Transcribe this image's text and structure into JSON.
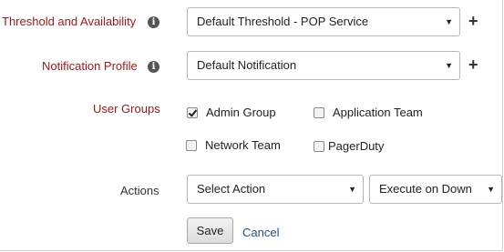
{
  "threshold": {
    "label": "Threshold and Availability",
    "info_glyph": "i",
    "selected": "Default Threshold - POP Service",
    "caret": "▼",
    "add_glyph": "+"
  },
  "notification": {
    "label": "Notification Profile",
    "info_glyph": "i",
    "selected": "Default Notification",
    "caret": "▼",
    "add_glyph": "+"
  },
  "user_groups": {
    "label": "User Groups",
    "options": [
      {
        "label": "Admin Group",
        "checked": true
      },
      {
        "label": "Application Team",
        "checked": false
      },
      {
        "label": "Network Team",
        "checked": false
      },
      {
        "label": "PagerDuty",
        "checked": false
      }
    ]
  },
  "actions": {
    "label": "Actions",
    "action_selected": "Select Action",
    "trigger_selected": "Execute on Down",
    "caret": "▼"
  },
  "buttons": {
    "save": "Save",
    "cancel": "Cancel"
  },
  "colors": {
    "label_red": "#a31818",
    "link_blue": "#1f4e9a"
  },
  "icons": {
    "info": "info-icon",
    "add": "plus-icon",
    "dropdown": "chevron-down-icon",
    "checkbox_checked": "checkmark-icon"
  }
}
